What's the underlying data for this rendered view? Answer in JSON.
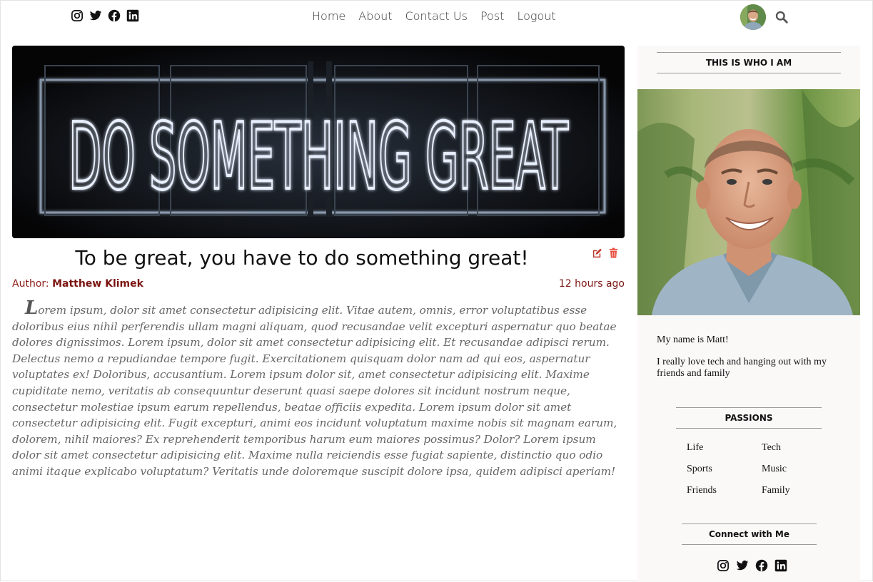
{
  "header": {
    "social_icons": [
      "instagram-icon",
      "twitter-icon",
      "facebook-icon",
      "linkedin-icon"
    ],
    "nav": [
      "Home",
      "About",
      "Contact Us",
      "Post",
      "Logout"
    ],
    "user_icon": "avatar",
    "search_icon": "search-icon"
  },
  "post": {
    "hero_sign_text": "DO SOMETHING GREAT",
    "title": "To be great, you have to do something great!",
    "author_label": "Author: ",
    "author_name": "Matthew Klimek",
    "time": "12 hours ago",
    "body_first_letter": "L",
    "body": "orem ipsum, dolor sit amet consectetur adipisicing elit. Vitae autem, omnis, error voluptatibus esse doloribus eius nihil perferendis ullam magni aliquam, quod recusandae velit excepturi aspernatur quo beatae dolores dignissimos. Lorem ipsum, dolor sit amet consectetur adipisicing elit. Et recusandae adipisci rerum. Delectus nemo a repudiandae tempore fugit. Exercitationem quisquam dolor nam ad qui eos, aspernatur voluptates ex! Doloribus, accusantium. Lorem ipsum dolor sit, amet consectetur adipisicing elit. Maxime cupiditate nemo, veritatis ab consequuntur deserunt quasi saepe dolores sit incidunt nostrum neque, consectetur molestiae ipsum earum repellendus, beatae officiis expedita. Lorem ipsum dolor sit amet consectetur adipisicing elit. Fugit excepturi, animi eos incidunt voluptatum maxime nobis sit magnam earum, dolorem, nihil maiores? Ex reprehenderit temporibus harum eum maiores possimus? Dolor? Lorem ipsum dolor sit amet consectetur adipisicing elit. Maxime nulla reiciendis esse fugiat sapiente, distinctio quo odio animi itaque explicabo voluptatum? Veritatis unde doloremque suscipit dolore ipsa, quidem adipisci aperiam!",
    "actions": [
      "edit-icon",
      "trash-icon"
    ],
    "colors": {
      "author": "#7a1410",
      "edit": "#c0392b",
      "trash": "#e74c3c"
    }
  },
  "sidebar": {
    "about_heading": "THIS IS WHO I AM",
    "bio": [
      "My name is Matt!",
      "I really love tech and hanging out with my friends and family"
    ],
    "passions_heading": "PASSIONS",
    "passions": [
      "Life",
      "Tech",
      "Sports",
      "Music",
      "Friends",
      "Family"
    ],
    "connect_heading": "Connect with Me",
    "social_icons": [
      "instagram-icon",
      "twitter-icon",
      "facebook-icon",
      "linkedin-icon"
    ]
  }
}
